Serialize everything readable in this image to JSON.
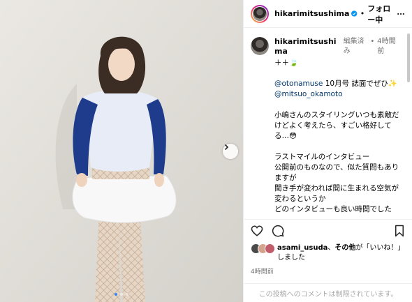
{
  "header": {
    "username": "hikarimitsushima",
    "separator": "•",
    "follow_label": "フォロー中"
  },
  "caption": {
    "username": "hikarimitsushima",
    "edited_label": "編集済み",
    "time_separator": "•",
    "time_ago": "4時間前",
    "lines": {
      "l1": "＋＋🍃",
      "mention1": "@otonamuse",
      "l2_rest": " 10月号 誌面でぜひ✨",
      "mention2": "@mitsuo_okamoto",
      "p2": "小嶋さんのスタイリングいつも素敵だけどよく考えたら、すごい格好してる…😳",
      "p3a": "ラストマイルのインタビュー",
      "p3b": "公開前のものなので、似た質問もありますが",
      "p3c": "聞き手が変われば間に生まれる空気が変わるというか",
      "p3d": "どのインタビューも良い時間でした",
      "p4": "♡"
    }
  },
  "likes": {
    "user": "asami_usuda",
    "mid": "、",
    "others": "その他",
    "suffix": "が「いいね！」しました"
  },
  "post_time": "4時間前",
  "comment_box": {
    "disabled_text": "この投稿へのコメントは制限されています。"
  },
  "carousel": {
    "total": 3,
    "active": 1
  },
  "colors": {
    "accent_blue": "#0095f6",
    "verified_blue": "#0095f6",
    "mention": "#00376b",
    "muted": "#737373",
    "active_dot": "#3b82f6"
  },
  "icons": {
    "heart": "heart-icon",
    "comment": "comment-icon",
    "bookmark": "bookmark-icon",
    "more": "more-icon",
    "verified": "verified-badge-icon",
    "next": "chevron-right-icon"
  }
}
